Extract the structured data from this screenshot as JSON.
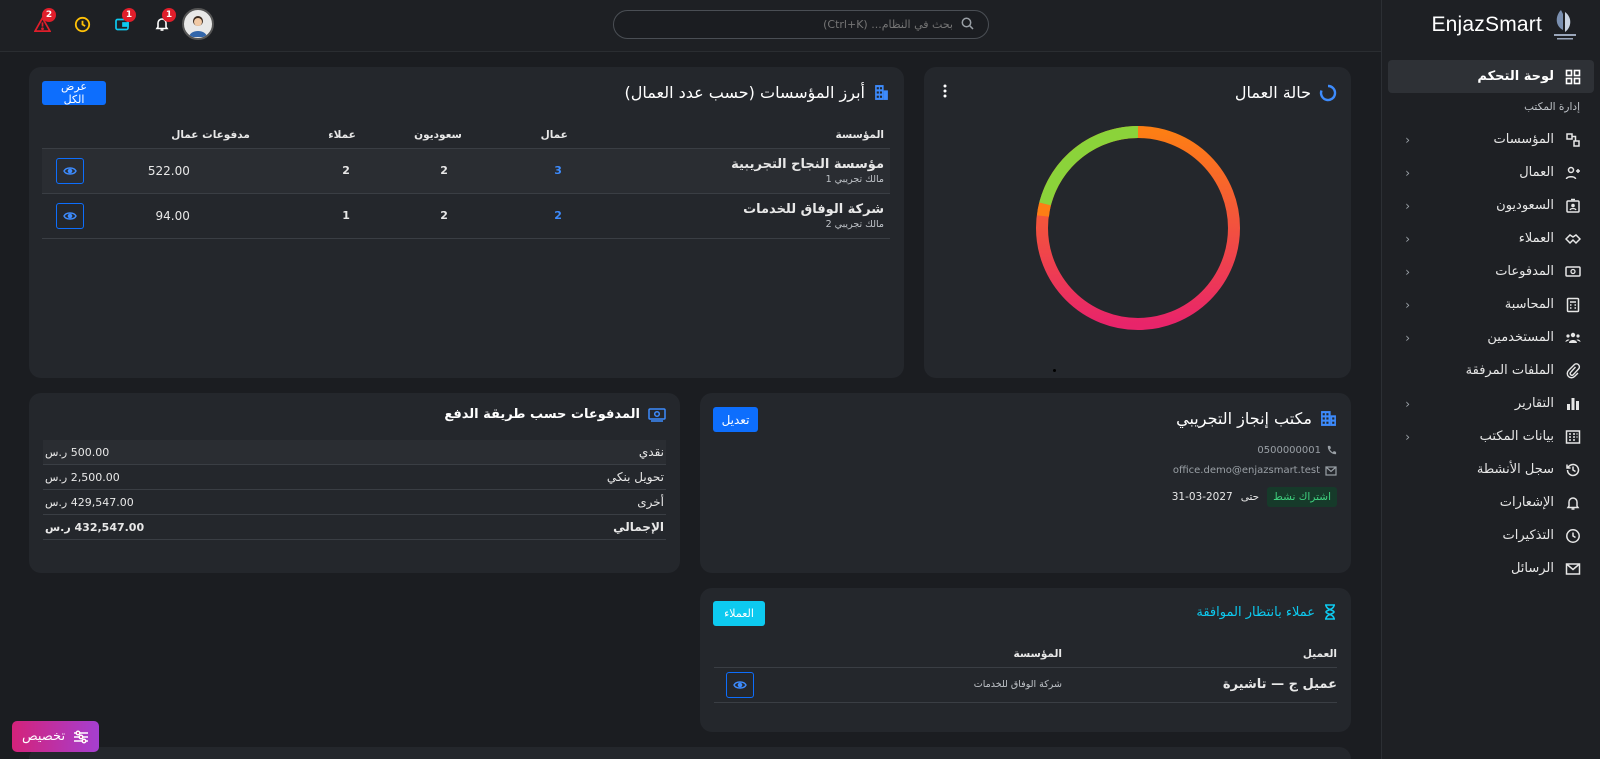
{
  "brand": {
    "name": "EnjazSmart"
  },
  "sidebar": {
    "active": {
      "label": "لوحة التحكم",
      "icon": "dashboard-icon"
    },
    "section": "إدارة المكتب",
    "items": [
      {
        "label": "المؤسسات",
        "icon": "organization-icon",
        "chevron": true
      },
      {
        "label": "العمال",
        "icon": "workers-icon",
        "chevron": true
      },
      {
        "label": "السعوديون",
        "icon": "id-badge-icon",
        "chevron": true
      },
      {
        "label": "العملاء",
        "icon": "handshake-icon",
        "chevron": true
      },
      {
        "label": "المدفوعات",
        "icon": "money-icon",
        "chevron": true
      },
      {
        "label": "المحاسبة",
        "icon": "calculator-icon",
        "chevron": true
      },
      {
        "label": "المستخدمين",
        "icon": "users-icon",
        "chevron": true
      },
      {
        "label": "الملفات المرفقة",
        "icon": "paperclip-icon",
        "chevron": false
      },
      {
        "label": "التقارير",
        "icon": "bar-chart-icon",
        "chevron": true
      },
      {
        "label": "بيانات المكتب",
        "icon": "building-icon",
        "chevron": true
      },
      {
        "label": "سجل الأنشطة",
        "icon": "history-icon",
        "chevron": false
      },
      {
        "label": "الإشعارات",
        "icon": "bell-icon",
        "chevron": false
      },
      {
        "label": "التذكيرات",
        "icon": "clock-icon",
        "chevron": false
      },
      {
        "label": "الرسائل",
        "icon": "mail-icon",
        "chevron": false
      }
    ]
  },
  "topbar": {
    "search_placeholder": "بحث في النظام... (Ctrl+K)",
    "badges": {
      "notifications": "1",
      "wallet": "1",
      "alerts": "2"
    },
    "colors": {
      "wallet": "#0dcaf0",
      "clock": "#ffc107",
      "alert": "#e01e2b"
    }
  },
  "workers_status": {
    "title": "حالة العمال",
    "colors": [
      "#fd7e14",
      "#e8246a",
      "#8bd33a"
    ]
  },
  "top_orgs": {
    "title": "أبرز المؤسسات (حسب عدد العمال)",
    "view_all": "عرض الكل",
    "columns": [
      "المؤسسة",
      "عمال",
      "سعوديون",
      "عملاء",
      "مدفوعات عمال"
    ],
    "rows": [
      {
        "name": "مؤسسة النجاح التجريبية",
        "owner": "مالك تجريبي 1",
        "workers": "3",
        "saudis": "2",
        "clients": "2",
        "payments": "522.00"
      },
      {
        "name": "شركة الوفاق للخدمات",
        "owner": "مالك تجريبي 2",
        "workers": "2",
        "saudis": "2",
        "clients": "1",
        "payments": "94.00"
      }
    ]
  },
  "office": {
    "title": "مكتب إنجاز التجريبي",
    "edit": "تعديل",
    "phone": "0500000001",
    "email": "office.demo@enjazsmart.test",
    "status": "اشتراك نشط",
    "until_label": "حتى",
    "until_date": "31-03-2027"
  },
  "payments_method": {
    "title": "المدفوعات حسب طريقة الدفع",
    "rows": [
      {
        "label": "نقدي",
        "value": "500.00 ر.س"
      },
      {
        "label": "تحويل بنكي",
        "value": "2,500.00 ر.س"
      },
      {
        "label": "أخرى",
        "value": "429,547.00 ر.س"
      }
    ],
    "total_label": "الإجمالي",
    "total_value": "432,547.00 ر.س"
  },
  "pending_clients": {
    "title": "عملاء بانتظار الموافقة",
    "button": "العملاء",
    "columns": [
      "العميل",
      "المؤسسة"
    ],
    "rows": [
      {
        "client": "عميل ج — تاشيرة",
        "org": "شركة الوفاق للخدمات"
      }
    ]
  },
  "customize": {
    "label": "تخصيص"
  }
}
